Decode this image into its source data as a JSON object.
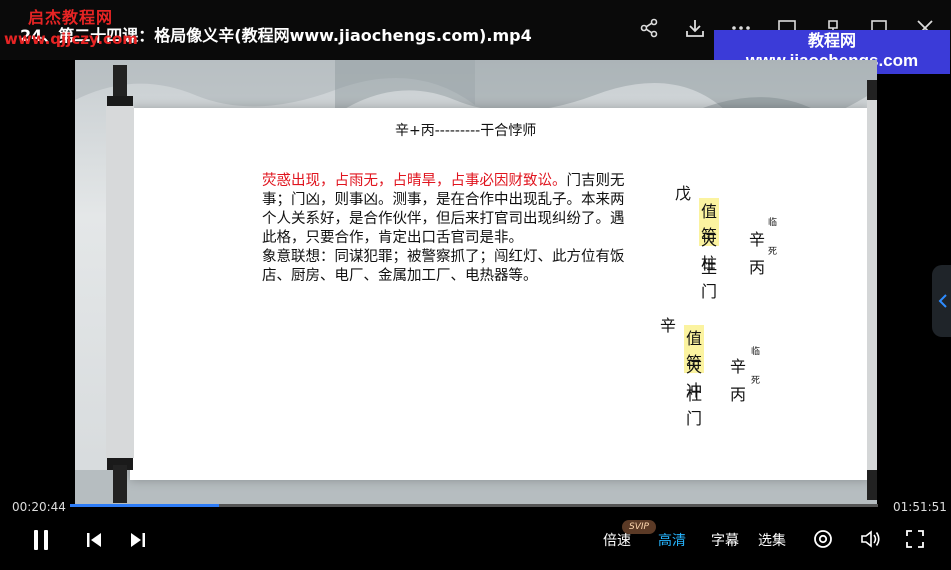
{
  "watermark": {
    "top_left_line1": "启杰教程网",
    "top_left_line2": "www.qjjczy.com",
    "box_line1": "教程网",
    "box_line2": "www.jiaochengs.com"
  },
  "player": {
    "title": "24、第二十四课：格局像义辛(教程网www.jiaochengs.com).mp4",
    "current_time": "00:20:44",
    "total_time": "01:51:51",
    "progress_fraction": 0.185,
    "speed_label": "倍速",
    "speed_badge": "SVIP",
    "quality_label": "高清",
    "subtitle_label": "字幕",
    "episodes_label": "选集",
    "accent_color": "#26b5ff"
  },
  "slide": {
    "heading": "辛+丙---------干合悖师",
    "para_red": "荧惑出现，占雨无，占晴旱，占事必因财致讼。",
    "para_rest1": "门吉则无事；门凶，则事凶。测事，是在合作中出现乱子。本来两个人关系好，是合作伙伴，但后来打官司出现纠纷了。遇此格，只要合作，肯定出口舌官司是非。",
    "para_rest2": "象意联想：同谋犯罪；被警察抓了；闯红灯、此方位有饭店、厨房、电厂、金属加工厂、电热器等。",
    "chart1": {
      "stem": "戊",
      "zhifu": "值符",
      "star": "天柱",
      "star_stem": "辛",
      "star_sup": "临",
      "door": "生门",
      "door_stem": "丙",
      "door_sup": "死"
    },
    "chart2": {
      "stem": "辛",
      "zhifu": "值符",
      "star": "天冲",
      "star_stem": "辛",
      "star_sup": "临",
      "door": "杜门",
      "door_stem": "丙",
      "door_sup": "死"
    }
  }
}
